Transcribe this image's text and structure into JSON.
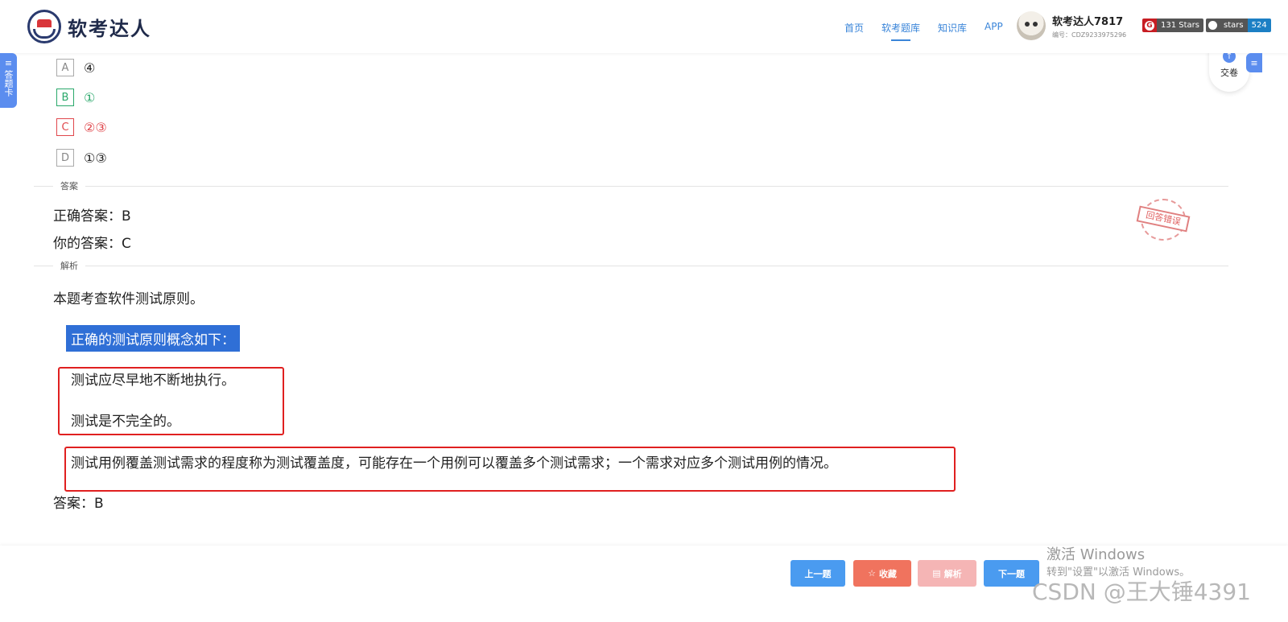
{
  "header": {
    "logo_text": "软考达人",
    "nav": [
      "首页",
      "软考题库",
      "知识库",
      "APP"
    ],
    "user_name": "软考达人7817",
    "user_id": "编号：CDZ9233975296",
    "badge_gitee": "131 Stars",
    "badge_github_label": "stars",
    "badge_github_count": "524"
  },
  "side": {
    "answer_card": "答题卡",
    "submit_label": "交卷"
  },
  "options": [
    {
      "key": "A",
      "value": "④",
      "state": "normal"
    },
    {
      "key": "B",
      "value": "①",
      "state": "correct"
    },
    {
      "key": "C",
      "value": "②③",
      "state": "wrong"
    },
    {
      "key": "D",
      "value": "①③",
      "state": "normal"
    }
  ],
  "answer": {
    "section_title": "答案",
    "correct_label": "正确答案：B",
    "yours_label": "你的答案：C",
    "stamp": "回答错误"
  },
  "analysis": {
    "section_title": "解析",
    "intro": "本题考查软件测试原则。",
    "highlight": "正确的测试原则概念如下：",
    "p1": "测试应尽早地不断地执行。",
    "p2": "测试是不完全的。",
    "p3": "测试用例覆盖测试需求的程度称为测试覆盖度，可能存在一个用例可以覆盖多个测试需求；一个需求对应多个测试用例的情况。",
    "final": "答案：B"
  },
  "buttons": {
    "prev": "上一题",
    "fav": "收藏",
    "analysis": "解析",
    "next": "下一题"
  },
  "watermark": {
    "line1": "激活 Windows",
    "line2": "转到\"设置\"以激活 Windows。",
    "csdn": "CSDN @王大锤4391"
  },
  "colors": {
    "accent": "#3a85d9",
    "correct": "#2aa86b",
    "wrong": "#e0474c",
    "highlight": "#2f6fd6"
  }
}
